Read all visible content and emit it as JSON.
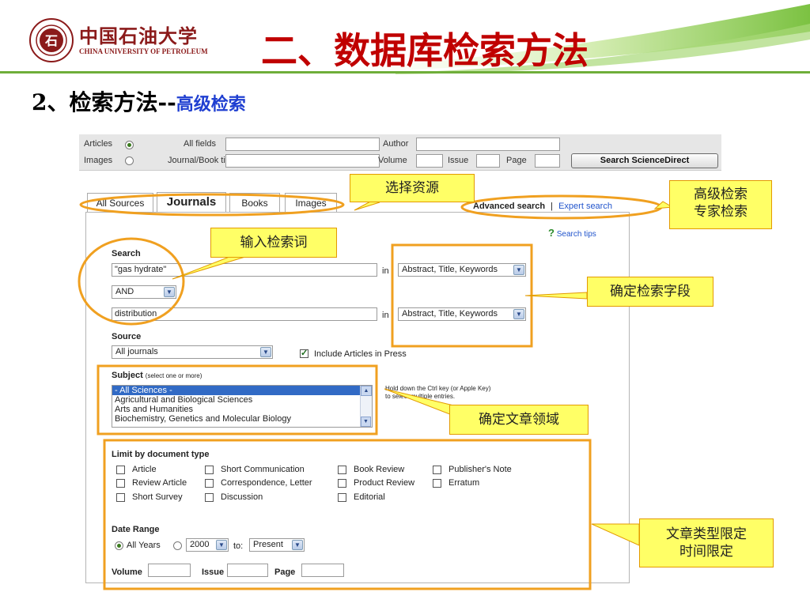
{
  "header": {
    "university_cn": "中国石油大学",
    "university_en": "CHINA UNIVERSITY OF PETROLEUM",
    "slide_title": "二、数据库检索方法",
    "subtitle_prefix": "2、检索方法--",
    "subtitle_highlight": "高级检索"
  },
  "quicksearch": {
    "articles_label": "Articles",
    "images_label": "Images",
    "all_fields_label": "All fields",
    "journal_label": "Journal/Book title",
    "author_label": "Author",
    "volume_label": "Volume",
    "issue_label": "Issue",
    "page_label": "Page",
    "search_button": "Search ScienceDirect"
  },
  "tabs": [
    "All Sources",
    "Journals",
    "Books",
    "Images"
  ],
  "links": {
    "advanced": "Advanced search",
    "separator": "|",
    "expert": "Expert search",
    "search_tips": "Search tips"
  },
  "form": {
    "search_label": "Search",
    "term1": "\"gas hydrate\"",
    "in1": "in",
    "field1": "Abstract, Title, Keywords",
    "operator": "AND",
    "term2": "distribution",
    "in2": "in",
    "field2": "Abstract, Title, Keywords",
    "source_label": "Source",
    "source_value": "All journals",
    "include_press": "Include Articles in Press",
    "subject_label": "Subject",
    "subject_hint": "(select one or more)",
    "subjects": [
      "- All Sciences -",
      "Agricultural and Biological Sciences",
      "Arts and Humanities",
      "Biochemistry, Genetics and Molecular Biology"
    ],
    "ctrl_hint_1": "Hold down the Ctrl key (or Apple Key)",
    "ctrl_hint_2": "to select multiple entries.",
    "doctype_label": "Limit by document type",
    "doctypes": [
      [
        "Article",
        "Short Communication",
        "Book Review",
        "Publisher's Note"
      ],
      [
        "Review Article",
        "Correspondence, Letter",
        "Product Review",
        "Erratum"
      ],
      [
        "Short Survey",
        "Discussion",
        "Editorial"
      ]
    ],
    "date_label": "Date Range",
    "all_years": "All Years",
    "from_year": "2000",
    "to_label": "to:",
    "to_value": "Present",
    "volume_label": "Volume",
    "issue_label": "Issue",
    "page_label": "Page"
  },
  "annotations": {
    "source": "选择资源",
    "keyword": "输入检索词",
    "advanced_1": "高级检索",
    "advanced_2": "专家检索",
    "field": "确定检索字段",
    "domain": "确定文章领域",
    "limit_1": "文章类型限定",
    "limit_2": "时间限定"
  },
  "colors": {
    "title_red": "#c00000",
    "highlight_blue": "#1f3fd1",
    "annotation_orange": "#f0a020",
    "note_yellow": "#ffff66"
  }
}
